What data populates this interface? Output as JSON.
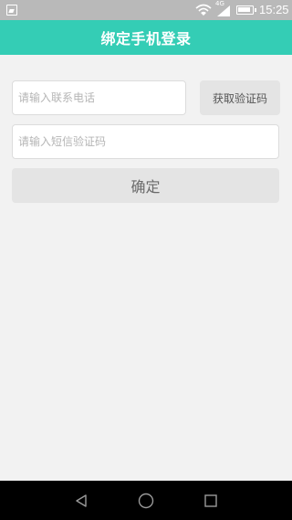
{
  "status_bar": {
    "time": "15:25",
    "network_label": "4G",
    "icons": [
      "image-icon",
      "wifi-icon",
      "signal-icon",
      "battery-icon"
    ]
  },
  "title_bar": {
    "title": "绑定手机登录",
    "background_color": "#34cdb5"
  },
  "form": {
    "phone_placeholder": "请输入联系电话",
    "phone_value": "",
    "get_code_label": "获取验证码",
    "sms_code_placeholder": "请输入短信验证码",
    "sms_code_value": "",
    "confirm_label": "确定"
  },
  "nav_bar": {
    "icons": [
      "back-icon",
      "home-icon",
      "recent-apps-icon"
    ]
  }
}
